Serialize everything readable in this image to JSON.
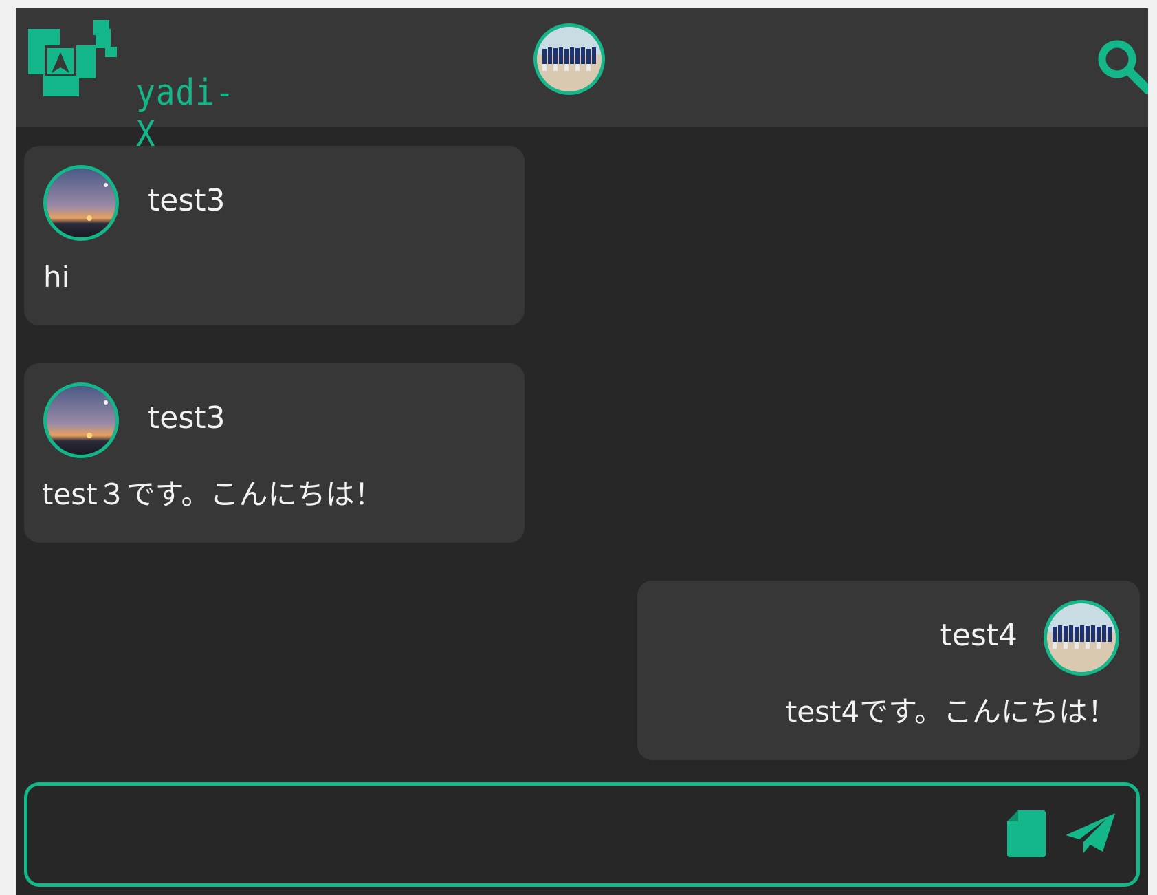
{
  "header": {
    "logo_text": "yadi-X",
    "current_user_avatar": "group-photo-avatar",
    "search_icon": "search-icon"
  },
  "messages": [
    {
      "side": "left",
      "username": "test3",
      "text": "hi",
      "avatar": "sunset-avatar"
    },
    {
      "side": "left",
      "username": "test3",
      "text": "test３です。こんにちは！",
      "avatar": "sunset-avatar"
    },
    {
      "side": "right",
      "username": "test4",
      "text": "test4です。こんにちは！",
      "avatar": "group-photo-avatar"
    }
  ],
  "composer": {
    "placeholder": "",
    "attach_icon": "file-icon",
    "send_icon": "paper-plane-icon"
  },
  "colors": {
    "accent": "#14b789",
    "header_bg": "#373737",
    "page_bg": "#272727",
    "bubble_bg": "#373737",
    "text": "#f2f2f2"
  }
}
